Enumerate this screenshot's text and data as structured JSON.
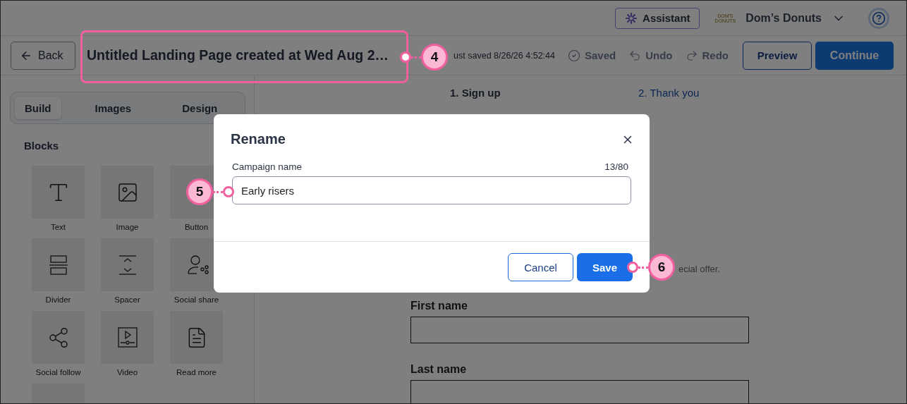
{
  "top_bar": {
    "assistant_button": "Assistant",
    "account": {
      "logo_lines": [
        "DOM'S",
        "DONUTS"
      ],
      "name": "Dom’s Donuts"
    }
  },
  "toolbar": {
    "back_button": "Back",
    "title": "Untitled Landing Page created at Wed Aug 2…",
    "save_status": "ust saved 8/26/26 4:52:44",
    "actions": [
      {
        "kind": "saved",
        "label": "Saved",
        "disabled": true
      },
      {
        "kind": "undo",
        "label": "Undo",
        "disabled": true
      },
      {
        "kind": "redo",
        "label": "Redo",
        "disabled": true
      }
    ],
    "preview_button": "Preview",
    "continue_button": "Continue"
  },
  "sidebar": {
    "tabs": [
      {
        "label": "Build",
        "selected": true
      },
      {
        "label": "Images",
        "selected": false
      },
      {
        "label": "Design",
        "selected": false
      }
    ],
    "section_title": "Blocks",
    "blocks": [
      {
        "kind": "text",
        "label": "Text"
      },
      {
        "kind": "image",
        "label": "Image"
      },
      {
        "kind": "button",
        "label": "Button"
      },
      {
        "kind": "divider",
        "label": "Divider"
      },
      {
        "kind": "spacer",
        "label": "Spacer"
      },
      {
        "kind": "social_share",
        "label": "Social share"
      },
      {
        "kind": "social_follow",
        "label": "Social follow"
      },
      {
        "kind": "video",
        "label": "Video"
      },
      {
        "kind": "read_more",
        "label": "Read more"
      },
      {
        "kind": "more"
      }
    ]
  },
  "canvas": {
    "steps": [
      {
        "number": "1.",
        "label": "Sign up",
        "selected": true
      },
      {
        "number": "2.",
        "label": "Thank you",
        "selected": false
      }
    ],
    "intro_text": "ecial offer.",
    "fields": [
      {
        "label": "First name"
      },
      {
        "label": "Last name"
      }
    ]
  },
  "dialog": {
    "title": "Rename",
    "field_label": "Campaign name",
    "counter": "13/80",
    "value": "Early risers",
    "cancel_button": "Cancel",
    "save_button": "Save"
  },
  "callouts": [
    {
      "number": "4"
    },
    {
      "number": "5"
    },
    {
      "number": "6"
    }
  ]
}
